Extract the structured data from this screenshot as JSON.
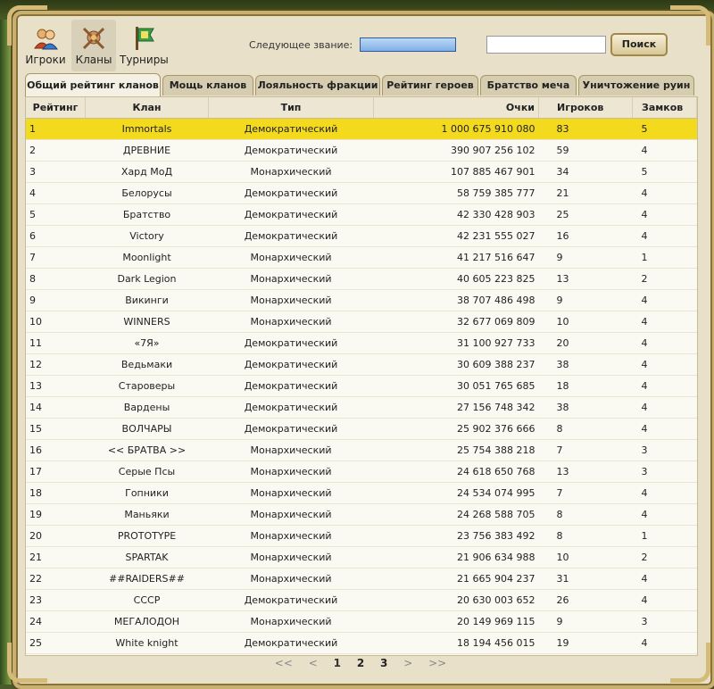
{
  "nav": {
    "items": [
      {
        "label": "Игроки",
        "icon": "players-icon"
      },
      {
        "label": "Кланы",
        "icon": "clans-icon"
      },
      {
        "label": "Турниры",
        "icon": "tournaments-icon"
      }
    ]
  },
  "rank": {
    "label": "Следующее звание:",
    "progress": 1.0
  },
  "search": {
    "value": "",
    "button": "Поиск"
  },
  "tabs": [
    {
      "label": "Общий рейтинг кланов",
      "active": true
    },
    {
      "label": "Мощь кланов"
    },
    {
      "label": "Лояльность фракции"
    },
    {
      "label": "Рейтинг героев"
    },
    {
      "label": "Братство меча"
    },
    {
      "label": "Уничтожение руин"
    }
  ],
  "table": {
    "columns": [
      "Рейтинг",
      "Клан",
      "Тип",
      "Очки",
      "Игроков",
      "Замков"
    ],
    "rows": [
      [
        "1",
        "Immortals",
        "Демократический",
        "1 000 675 910 080",
        "83",
        "5"
      ],
      [
        "2",
        "ДРЕВНИЕ",
        "Демократический",
        "390 907 256 102",
        "59",
        "4"
      ],
      [
        "3",
        "Хард МоД",
        "Монархический",
        "107 885 467 901",
        "34",
        "5"
      ],
      [
        "4",
        "Белорусы",
        "Демократический",
        "58 759 385 777",
        "21",
        "4"
      ],
      [
        "5",
        "Братство",
        "Демократический",
        "42 330 428 903",
        "25",
        "4"
      ],
      [
        "6",
        "Victory",
        "Демократический",
        "42 231 555 027",
        "16",
        "4"
      ],
      [
        "7",
        "Moonlight",
        "Монархический",
        "41 217 516 647",
        "9",
        "1"
      ],
      [
        "8",
        "Dark Legion",
        "Монархический",
        "40 605 223 825",
        "13",
        "2"
      ],
      [
        "9",
        "Викинги",
        "Монархический",
        "38 707 486 498",
        "9",
        "4"
      ],
      [
        "10",
        "WINNERS",
        "Монархический",
        "32 677 069 809",
        "10",
        "4"
      ],
      [
        "11",
        "«7Я»",
        "Демократический",
        "31 100 927 733",
        "20",
        "4"
      ],
      [
        "12",
        "Ведьмаки",
        "Демократический",
        "30 609 388 237",
        "38",
        "4"
      ],
      [
        "13",
        "Староверы",
        "Демократический",
        "30 051 765 685",
        "18",
        "4"
      ],
      [
        "14",
        "Вардены",
        "Демократический",
        "27 156 748 342",
        "38",
        "4"
      ],
      [
        "15",
        "ВОЛЧАРЫ",
        "Демократический",
        "25 902 376 666",
        "8",
        "4"
      ],
      [
        "16",
        "<< БРАТВА >>",
        "Монархический",
        "25 754 388 218",
        "7",
        "3"
      ],
      [
        "17",
        "Серые Псы",
        "Монархический",
        "24 618 650 768",
        "13",
        "3"
      ],
      [
        "18",
        "Гопники",
        "Монархический",
        "24 534 074 995",
        "7",
        "4"
      ],
      [
        "19",
        "Маньяки",
        "Монархический",
        "24 268 588 705",
        "8",
        "4"
      ],
      [
        "20",
        "PROTOTYPE",
        "Монархический",
        "23 756 383 492",
        "8",
        "1"
      ],
      [
        "21",
        "SPARTAK",
        "Монархический",
        "21 906 634 988",
        "10",
        "2"
      ],
      [
        "22",
        "##RAIDERS##",
        "Монархический",
        "21 665 904 237",
        "31",
        "4"
      ],
      [
        "23",
        "СССР",
        "Демократический",
        "20 630 003 652",
        "26",
        "4"
      ],
      [
        "24",
        "МЕГАЛОДОН",
        "Монархический",
        "20 149 969 115",
        "9",
        "3"
      ],
      [
        "25",
        "White knight",
        "Демократический",
        "18 194 456 015",
        "19",
        "4"
      ]
    ]
  },
  "pagination": {
    "items": [
      "<<",
      "<",
      "1",
      "2",
      "3",
      ">",
      ">>"
    ]
  },
  "colors": {
    "highlight_row": "#f3da1e",
    "frame_gold": "#c8b070",
    "rank_bar": "#7fb0e8"
  }
}
